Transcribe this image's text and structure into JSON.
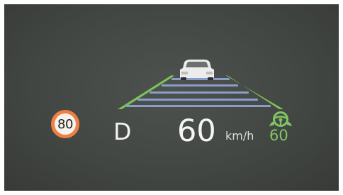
{
  "hud": {
    "speed_limit": "80",
    "gear": "D",
    "speed": "60",
    "speed_unit": "km/h",
    "cruise_speed": "60"
  },
  "icons": {
    "speed_limit": "speed-limit-sign-icon",
    "lead_vehicle": "car-icon",
    "cruise": "steering-wheel-icon"
  },
  "colors": {
    "background": "#434743",
    "lane_line": "#7cc256",
    "lane_stripe": "#8fa6d6",
    "speed_limit_ring": "#ef7f45",
    "cruise_accent": "#82c464"
  }
}
